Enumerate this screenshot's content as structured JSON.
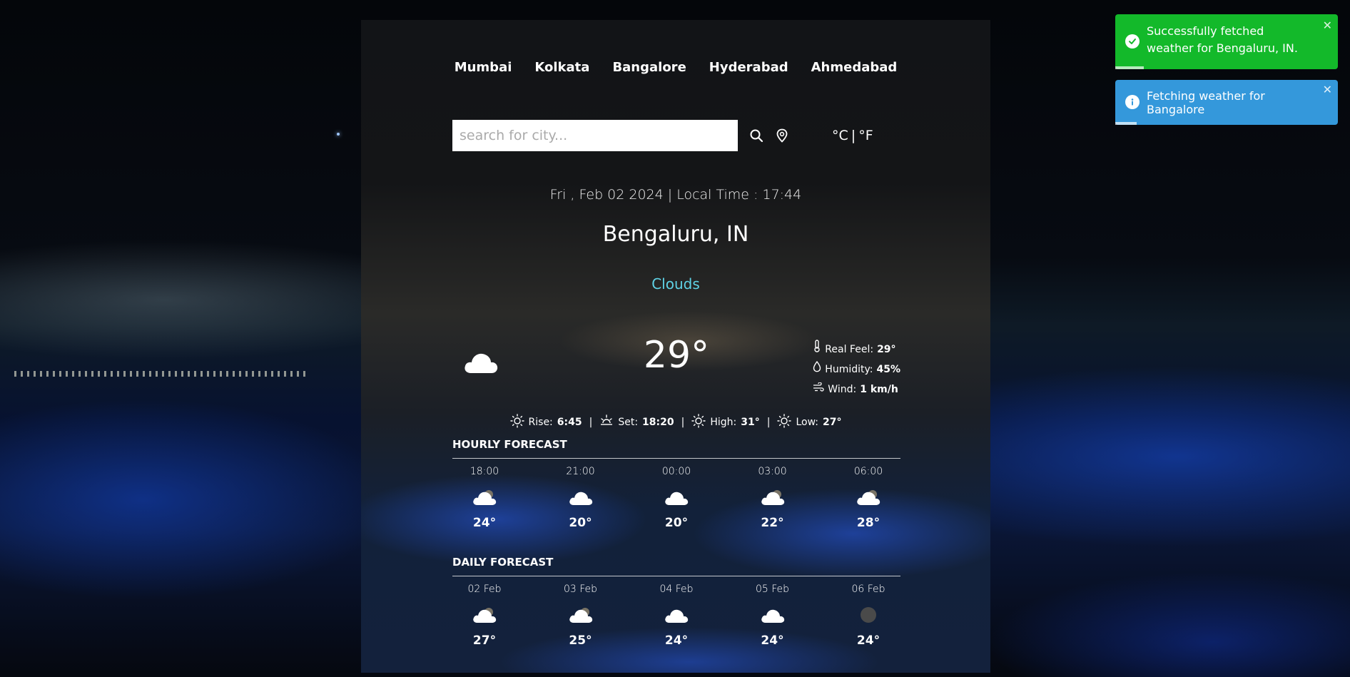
{
  "nav": {
    "cities": [
      "Mumbai",
      "Kolkata",
      "Bangalore",
      "Hyderabad",
      "Ahmedabad"
    ]
  },
  "search": {
    "placeholder": "search for city...",
    "value": ""
  },
  "units": {
    "celsius": "°C",
    "separator": "|",
    "fahrenheit": "°F"
  },
  "weather": {
    "datetime": "Fri , Feb 02 2024 | Local Time : 17:44",
    "city": "Bengaluru, IN",
    "condition": "Clouds",
    "temperature": "29°",
    "details": {
      "real_feel_label": "Real Feel:",
      "real_feel_value": "29°",
      "humidity_label": "Humidity:",
      "humidity_value": "45%",
      "wind_label": "Wind:",
      "wind_value": "1 km/h"
    },
    "sun": {
      "rise_label": "Rise:",
      "rise_value": "6:45",
      "set_label": "Set:",
      "set_value": "18:20",
      "high_label": "High:",
      "high_value": "31°",
      "low_label": "Low:",
      "low_value": "27°",
      "separator": "|"
    }
  },
  "hourly": {
    "title": "HOURLY FORECAST",
    "items": [
      {
        "time": "18:00",
        "temp": "24°",
        "icon": "cloud-sun-icon"
      },
      {
        "time": "21:00",
        "temp": "20°",
        "icon": "cloud-icon"
      },
      {
        "time": "00:00",
        "temp": "20°",
        "icon": "cloud-icon"
      },
      {
        "time": "03:00",
        "temp": "22°",
        "icon": "cloud-sun-icon"
      },
      {
        "time": "06:00",
        "temp": "28°",
        "icon": "cloud-sun-icon"
      }
    ]
  },
  "daily": {
    "title": "DAILY FORECAST",
    "items": [
      {
        "date": "02 Feb",
        "temp": "27°",
        "icon": "cloud-sun-icon"
      },
      {
        "date": "03 Feb",
        "temp": "25°",
        "icon": "cloud-sun-icon"
      },
      {
        "date": "04 Feb",
        "temp": "24°",
        "icon": "cloud-icon"
      },
      {
        "date": "05 Feb",
        "temp": "24°",
        "icon": "cloud-icon"
      },
      {
        "date": "06 Feb",
        "temp": "24°",
        "icon": "overcast-icon"
      }
    ]
  },
  "toasts": {
    "success_text": "Successfully fetched weather for Bengaluru, IN.",
    "info_text": "Fetching weather for Bangalore",
    "close_label": "✕"
  },
  "colors": {
    "success": "#13b92a",
    "info": "#3498db",
    "condition": "#5fd3e6"
  }
}
